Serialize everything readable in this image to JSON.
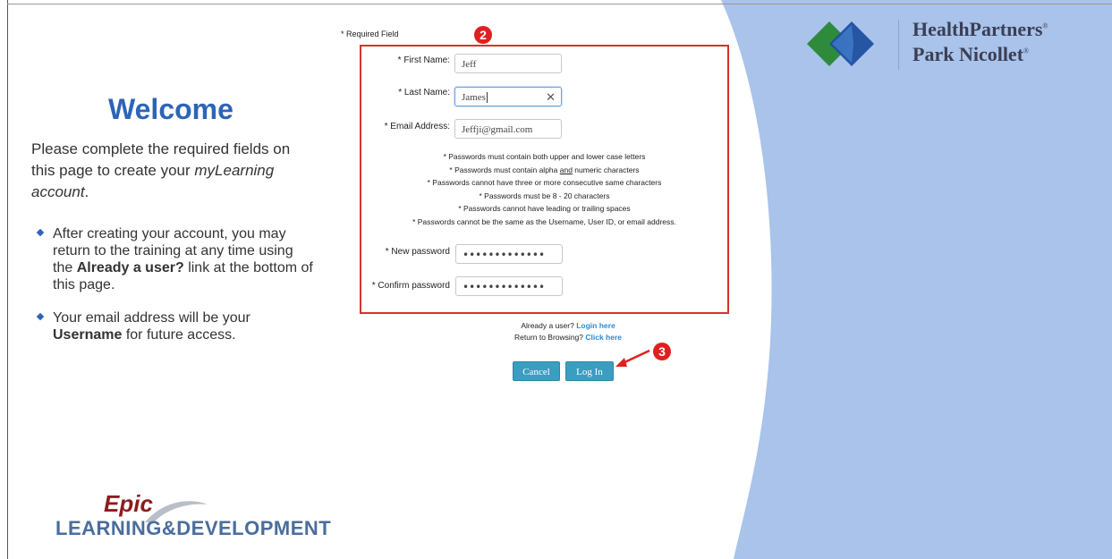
{
  "left_panel": {
    "title": "Welcome",
    "intro_line1": "Please complete the required fields on",
    "intro_line2_prefix": "this page to create your ",
    "intro_line2_italic": "myLearning",
    "intro_line3_italic": "account",
    "intro_line3_suffix": ".",
    "bullet1_l1": "After creating your account, you may",
    "bullet1_l2": "return to the training at any time using",
    "bullet1_l3_prefix": "the ",
    "bullet1_l3_bold": "Already a user?",
    "bullet1_l3_suffix": " link at the bottom of",
    "bullet1_l4": "this page.",
    "bullet2_l1": "Your email address will be your",
    "bullet2_l2_bold": "Username",
    "bullet2_l2_suffix": " for future access."
  },
  "brand_bottom": {
    "epic": "Epic",
    "ld": "LEARNING&DEVELOPMENT"
  },
  "brand_top": {
    "line1": "HealthPartners",
    "line2": "Park Nicollet",
    "mark": "®"
  },
  "form": {
    "required_note": "* Required Field",
    "first_name_label": "* First Name:",
    "first_name_value": "Jeff",
    "last_name_label": "* Last Name:",
    "last_name_value": "James",
    "email_label": "* Email Address:",
    "email_value": "Jeffji@gmail.com",
    "rules": [
      "* Passwords must contain both upper and lower case letters",
      "* Passwords must contain alpha ",
      "and",
      " numeric characters",
      "* Passwords cannot have three or more consecutive same characters",
      "* Passwords must be 8 - 20 characters",
      "* Passwords cannot have leading or trailing spaces",
      "* Passwords cannot be the same as the Username, User ID, or email address."
    ],
    "new_password_label": "* New password",
    "new_password_value": "•••••••••••••",
    "confirm_password_label": "* Confirm password",
    "confirm_password_value": "•••••••••••••"
  },
  "links": {
    "already_user": "Already a user?",
    "login_here": "Login here",
    "return_browsing": "Return to Browsing?",
    "click_here": "Click here"
  },
  "buttons": {
    "cancel": "Cancel",
    "login": "Log In"
  },
  "annotations": {
    "badge2": "2",
    "badge3": "3"
  },
  "colors": {
    "accent_blue": "#2d64b8",
    "button": "#3a9ec0",
    "highlight_red": "#d23232",
    "bg_blue": "#a9c3ea"
  }
}
